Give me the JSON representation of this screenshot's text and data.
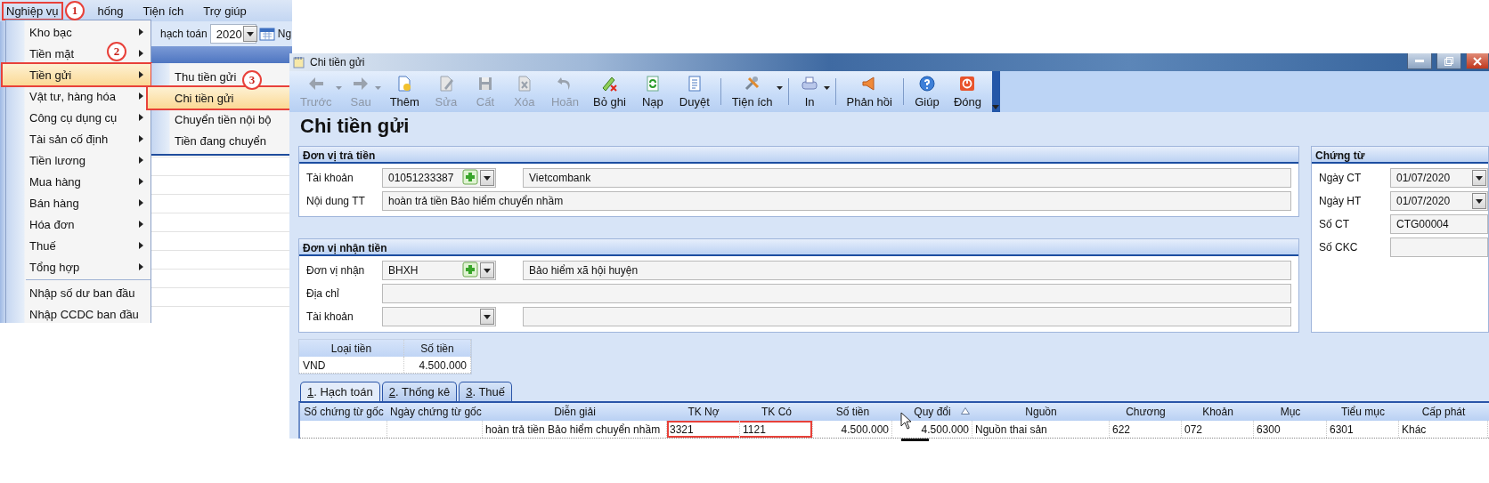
{
  "menu_shot": {
    "menubar": [
      {
        "label": "Nghiệp vụ",
        "selected": true
      },
      {
        "label": "hống",
        "selected": false
      },
      {
        "label": "Tiện ích",
        "selected": false
      },
      {
        "label": "Trợ giúp",
        "selected": false
      }
    ],
    "toolbar": {
      "label": "hạch toán",
      "year": "2020",
      "next_label": "Ng"
    },
    "menu": [
      [
        {
          "label": "Kho bạc",
          "selected": false,
          "has_submenu": true
        },
        {
          "label": "Tiền mặt",
          "selected": false,
          "has_submenu": true
        },
        {
          "label": "Tiền gửi",
          "selected": true,
          "has_submenu": true
        },
        {
          "label": "Vật tư, hàng hóa",
          "selected": false,
          "has_submenu": true
        },
        {
          "label": "Công cụ dụng cụ",
          "selected": false,
          "has_submenu": true
        },
        {
          "label": "Tài sản cố định",
          "selected": false,
          "has_submenu": true
        },
        {
          "label": "Tiền lương",
          "selected": false,
          "has_submenu": true
        },
        {
          "label": "Mua hàng",
          "selected": false,
          "has_submenu": true
        },
        {
          "label": "Bán hàng",
          "selected": false,
          "has_submenu": true
        },
        {
          "label": "Hóa đơn",
          "selected": false,
          "has_submenu": true
        },
        {
          "label": "Thuế",
          "selected": false,
          "has_submenu": true
        },
        {
          "label": "Tổng hợp",
          "selected": false,
          "has_submenu": true
        }
      ],
      [
        {
          "label": "Nhập số dư ban đầu",
          "selected": false,
          "has_submenu": false
        },
        {
          "label": "Nhập CCDC ban đầu",
          "selected": false,
          "has_submenu": false
        }
      ]
    ],
    "submenu": [
      {
        "label": "Thu tiền gửi",
        "selected": false
      },
      {
        "label": "Chi tiền gửi",
        "selected": true
      },
      {
        "label": "Chuyển tiền nội bộ",
        "selected": false
      },
      {
        "label": "Tiền đang chuyển",
        "selected": false
      }
    ],
    "callouts": [
      "1",
      "2",
      "3"
    ]
  },
  "window": {
    "title": "Chi tiền gửi",
    "toolbar": [
      [
        {
          "label": "Trước",
          "disabled": true,
          "dropdown": true
        },
        {
          "label": "Sau",
          "disabled": true,
          "dropdown": true
        },
        {
          "label": "Thêm",
          "disabled": false,
          "dropdown": false
        },
        {
          "label": "Sửa",
          "disabled": true,
          "dropdown": false
        },
        {
          "label": "Cất",
          "disabled": true,
          "dropdown": false
        },
        {
          "label": "Xóa",
          "disabled": true,
          "dropdown": false
        },
        {
          "label": "Hoãn",
          "disabled": true,
          "dropdown": false
        },
        {
          "label": "Bỏ ghi",
          "disabled": false,
          "dropdown": false
        },
        {
          "label": "Nạp",
          "disabled": false,
          "dropdown": false
        },
        {
          "label": "Duyệt",
          "disabled": false,
          "dropdown": false
        }
      ],
      [
        {
          "label": "Tiện ích",
          "disabled": false,
          "dropdown": true
        }
      ],
      [
        {
          "label": "In",
          "disabled": false,
          "dropdown": true
        }
      ],
      [
        {
          "label": "Phản hồi",
          "disabled": false,
          "dropdown": false
        }
      ],
      [
        {
          "label": "Giúp",
          "disabled": false,
          "dropdown": false
        },
        {
          "label": "Đóng",
          "disabled": false,
          "dropdown": false
        }
      ]
    ],
    "heading": "Chi tiền gửi",
    "payer": {
      "title": "Đơn vị trả tiền",
      "fields": [
        {
          "kind": "lookup",
          "label": "Tài khoản",
          "value": "01051233387",
          "name": "Vietcombank"
        },
        {
          "kind": "text",
          "label": "Nội dung TT",
          "value": "hoàn trả tiền Bảo hiểm chuyển nhầm"
        }
      ]
    },
    "payee": {
      "title": "Đơn vị nhận tiền",
      "fields": [
        {
          "kind": "lookup",
          "label": "Đơn vị nhận",
          "value": "BHXH",
          "name": "Bảo hiểm xã hội huyện"
        },
        {
          "kind": "text",
          "label": "Địa chỉ"
        },
        {
          "kind": "combo",
          "label": "Tài khoản"
        }
      ]
    },
    "voucher": {
      "title": "Chứng từ",
      "fields": [
        {
          "kind": "date",
          "label": "Ngày CT",
          "value": "01/07/2020"
        },
        {
          "kind": "date",
          "label": "Ngày HT",
          "value": "01/07/2020"
        },
        {
          "kind": "text",
          "label": "Số CT",
          "value": "CTG00004"
        },
        {
          "kind": "text",
          "label": "Số CKC"
        }
      ]
    },
    "currency_table": {
      "columns": [
        "Loại tiền",
        "Số tiền"
      ],
      "rows": [
        [
          "VND",
          "4.500.000"
        ]
      ]
    },
    "tabs": [
      {
        "key": "1",
        "label": ". Hạch toán",
        "selected": true
      },
      {
        "key": "2",
        "label": ". Thống kê",
        "selected": false
      },
      {
        "key": "3",
        "label": ". Thuế",
        "selected": false
      }
    ],
    "grid": {
      "columns": [
        {
          "label": "Số chứng từ gốc",
          "kind": "text",
          "sorted": false
        },
        {
          "label": "Ngày chứng từ gốc",
          "kind": "text",
          "sorted": false
        },
        {
          "label": "Diễn giải",
          "kind": "text",
          "sorted": false
        },
        {
          "label": "TK Nợ",
          "kind": "text",
          "sorted": false
        },
        {
          "label": "TK Có",
          "kind": "text",
          "sorted": false
        },
        {
          "label": "Số tiền",
          "kind": "amount",
          "sorted": false
        },
        {
          "label": "Quy đổi",
          "kind": "amount",
          "sorted": true
        },
        {
          "label": "Nguồn",
          "kind": "text",
          "sorted": false
        },
        {
          "label": "Chương",
          "kind": "text",
          "sorted": false
        },
        {
          "label": "Khoản",
          "kind": "text",
          "sorted": false
        },
        {
          "label": "Mục",
          "kind": "text",
          "sorted": false
        },
        {
          "label": "Tiểu mục",
          "kind": "text",
          "sorted": false
        },
        {
          "label": "Cấp phát",
          "kind": "text",
          "sorted": false
        }
      ],
      "rows": [
        {
          "cells": [
            {
              "highlighted": false
            },
            {
              "highlighted": false
            },
            {
              "text": "hoàn trả tiền Bảo hiểm chuyển nhầm",
              "highlighted": false
            },
            {
              "text": "3321",
              "highlighted": true
            },
            {
              "text": "1121",
              "highlighted": true
            },
            {
              "text": "4.500.000",
              "highlighted": false
            },
            {
              "text": "4.500.000",
              "highlighted": false
            },
            {
              "text": "Nguồn thai sản",
              "highlighted": false
            },
            {
              "text": "622",
              "highlighted": false
            },
            {
              "text": "072",
              "highlighted": false
            },
            {
              "text": "6300",
              "highlighted": false
            },
            {
              "text": "6301",
              "highlighted": false
            },
            {
              "text": "Khác",
              "highlighted": false
            }
          ]
        }
      ]
    }
  }
}
